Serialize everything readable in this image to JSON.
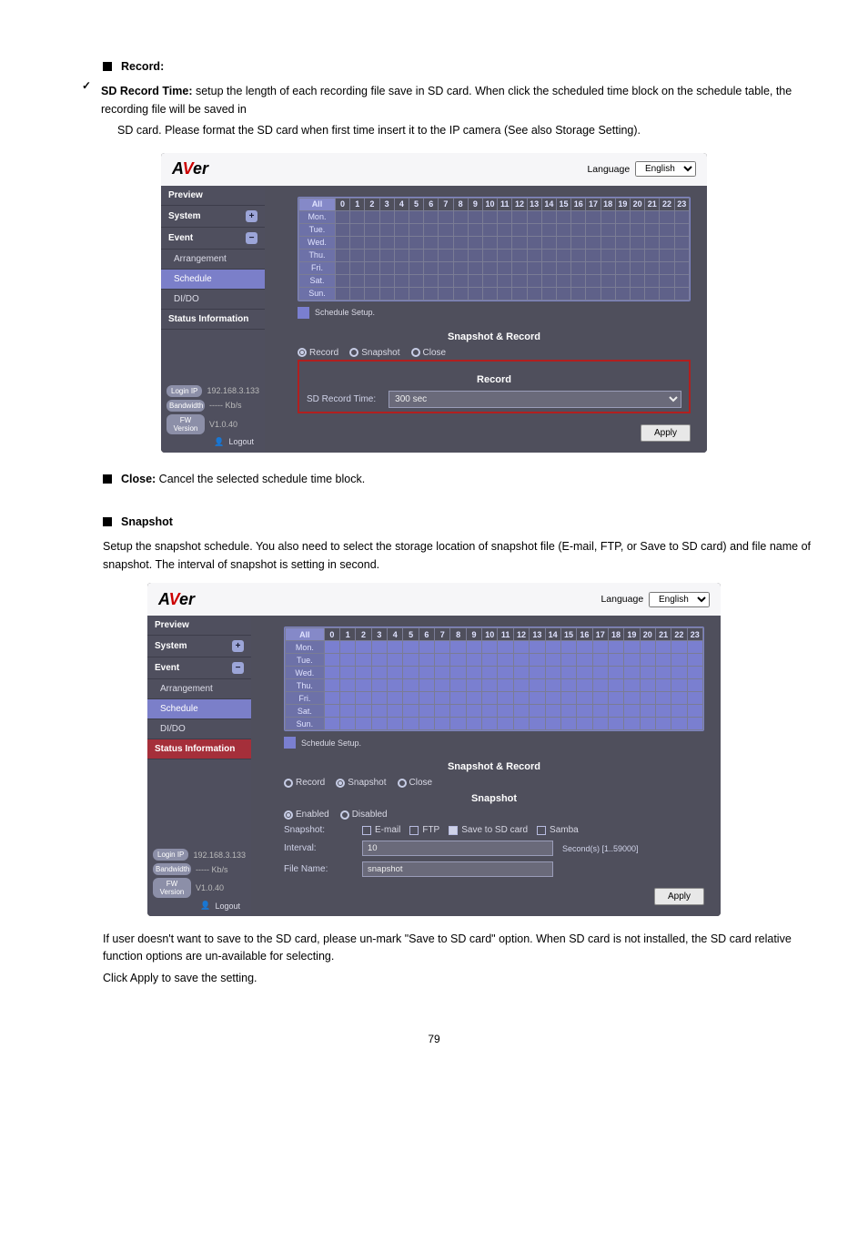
{
  "textblocks": {
    "b1": "Record:",
    "c1a": "SD Record Time:",
    "c1b": " setup the length of each recording file save in SD card. When click the scheduled time block on the schedule table, the recording file will be saved in",
    "c1c": "SD card. Please format the SD card when first time insert it to the IP camera (See also Storage Setting).",
    "b2": "Close:",
    "b2t": " Cancel the selected schedule time block.",
    "b3": "Snapshot",
    "c3a": "Setup the snapshot schedule. You also need to select the storage location of snapshot file (E-mail, FTP, or Save to SD card) and file name of snapshot. The interval of snapshot is setting in second.",
    "footer1": "If user doesn't want to save to the SD card, please un-mark \"Save to SD card\" option. When SD card is not installed, the SD card relative function options are un-available for selecting.",
    "footer2": "Click Apply to save the setting.",
    "pageno": "79"
  },
  "sidebar": {
    "preview": "Preview",
    "system": "System",
    "event": "Event",
    "arrangement": "Arrangement",
    "schedule": "Schedule",
    "dido": "DI/DO",
    "status": "Status Information"
  },
  "sidefoot": {
    "login": "Login IP",
    "loginval": "192.168.3.133",
    "bw": "Bandwidth",
    "bwval": "----- Kb/s",
    "fw": "FW Version",
    "fwval": "V1.0.40",
    "logout": "Logout"
  },
  "langbar": {
    "label": "Language",
    "val": "English"
  },
  "schedule": {
    "all": "All",
    "hours": [
      "0",
      "1",
      "2",
      "3",
      "4",
      "5",
      "6",
      "7",
      "8",
      "9",
      "10",
      "11",
      "12",
      "13",
      "14",
      "15",
      "16",
      "17",
      "18",
      "19",
      "20",
      "21",
      "22",
      "23"
    ],
    "days": [
      "Mon.",
      "Tue.",
      "Wed.",
      "Thu.",
      "Fri.",
      "Sat.",
      "Sun."
    ],
    "setup": "Schedule Setup."
  },
  "snr": {
    "head": "Snapshot & Record",
    "record": "Record",
    "snapshot": "Snapshot",
    "close": "Close",
    "recHead": "Record",
    "sdLabel": "SD Record Time:",
    "sdVal": "300 sec"
  },
  "snap": {
    "head": "Snapshot",
    "enabled": "Enabled",
    "disabled": "Disabled",
    "snapLab": "Snapshot:",
    "email": "E-mail",
    "ftp": "FTP",
    "sd": "Save to SD card",
    "samba": "Samba",
    "intLab": "Interval:",
    "intVal": "10",
    "intHint": "Second(s) [1..59000]",
    "fileLab": "File Name:",
    "fileVal": "snapshot"
  },
  "apply": "Apply"
}
